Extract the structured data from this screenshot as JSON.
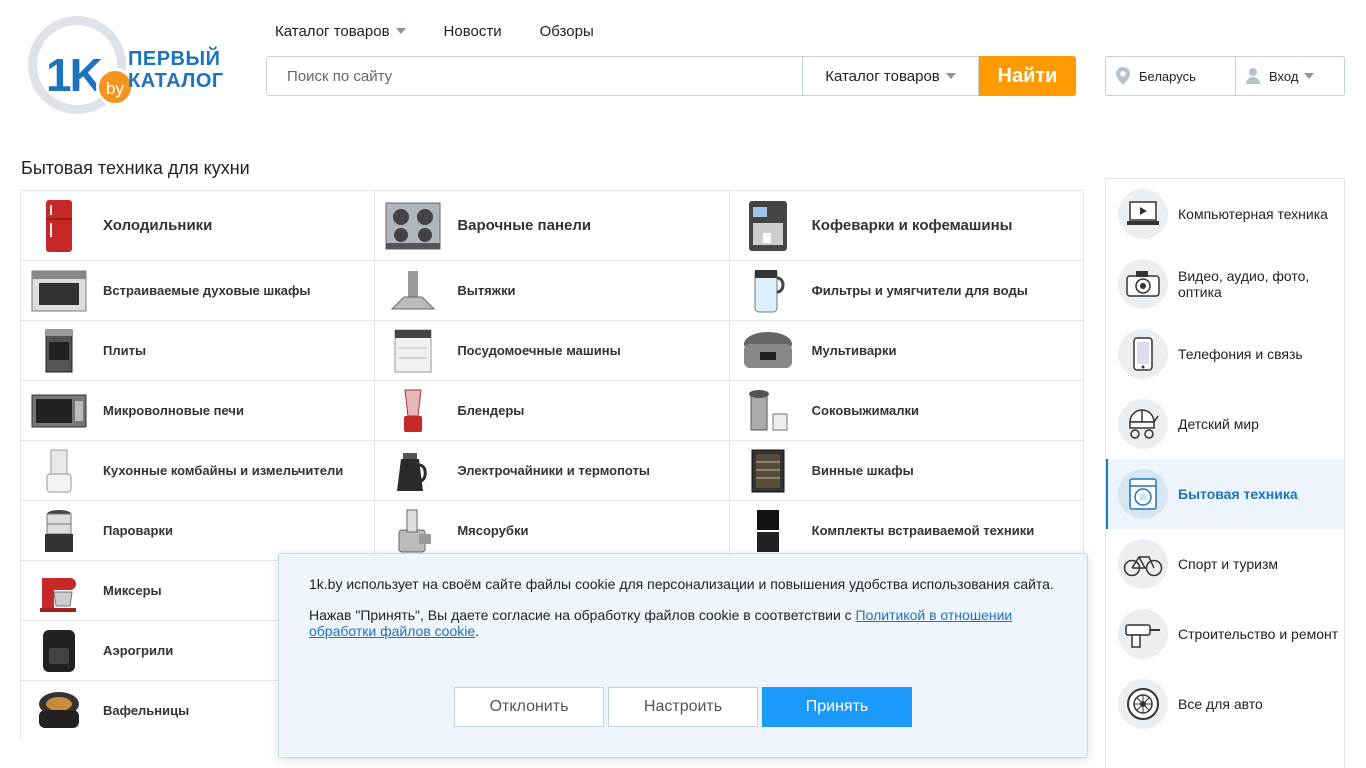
{
  "logo": {
    "mark": "1K",
    "badge": "by",
    "line1": "ПЕРВЫЙ",
    "line2": "КАТАЛОГ"
  },
  "topnav": [
    {
      "label": "Каталог товаров",
      "dropdown": true
    },
    {
      "label": "Новости",
      "dropdown": false
    },
    {
      "label": "Обзоры",
      "dropdown": false
    }
  ],
  "search": {
    "placeholder": "Поиск по сайту",
    "scope": "Каталог товаров",
    "button": "Найти"
  },
  "user": {
    "region": "Беларусь",
    "login": "Вход"
  },
  "section_title": "Бытовая техника для кухни",
  "categories": [
    [
      "Холодильники",
      "Варочные панели",
      "Кофеварки и кофемашины"
    ],
    [
      "Встраиваемые духовые шкафы",
      "Вытяжки",
      "Фильтры и умягчители для воды"
    ],
    [
      "Плиты",
      "Посудомоечные машины",
      "Мультиварки"
    ],
    [
      "Микроволновые печи",
      "Блендеры",
      "Соковыжималки"
    ],
    [
      "Кухонные комбайны и измельчители",
      "Электрочайники и термопоты",
      "Винные шкафы"
    ],
    [
      "Пароварки",
      "Мясорубки",
      "Комплекты встраиваемой техники"
    ],
    [
      "Миксеры",
      "",
      ""
    ],
    [
      "Аэрогрили",
      "",
      ""
    ],
    [
      "Вафельницы",
      "",
      ""
    ]
  ],
  "sidebar": [
    {
      "label": "Компьютерная техника",
      "icon": "laptop-icon"
    },
    {
      "label": "Видео, аудио, фото, оптика",
      "icon": "camera-icon"
    },
    {
      "label": "Телефония и связь",
      "icon": "phone-icon"
    },
    {
      "label": "Детский мир",
      "icon": "stroller-icon"
    },
    {
      "label": "Бытовая техника",
      "icon": "washing-machine-icon",
      "active": true
    },
    {
      "label": "Спорт и туризм",
      "icon": "bicycle-icon"
    },
    {
      "label": "Строительство и ремонт",
      "icon": "drill-icon"
    },
    {
      "label": "Все для авто",
      "icon": "wheel-icon"
    }
  ],
  "cookie": {
    "text1": "1k.by использует на своём сайте файлы cookie для персонализации и повышения удобства использования сайта.",
    "text2_prefix": "Нажав \"Принять\", Вы даете согласие на обработку файлов cookie в соответствии с ",
    "link": "Политикой в отношении обработки файлов cookie",
    "text2_suffix": ".",
    "decline": "Отклонить",
    "configure": "Настроить",
    "accept": "Принять"
  },
  "colors": {
    "brand": "#1e73be",
    "search_button": "#ff9a00",
    "accept_button": "#1a9bfc"
  }
}
